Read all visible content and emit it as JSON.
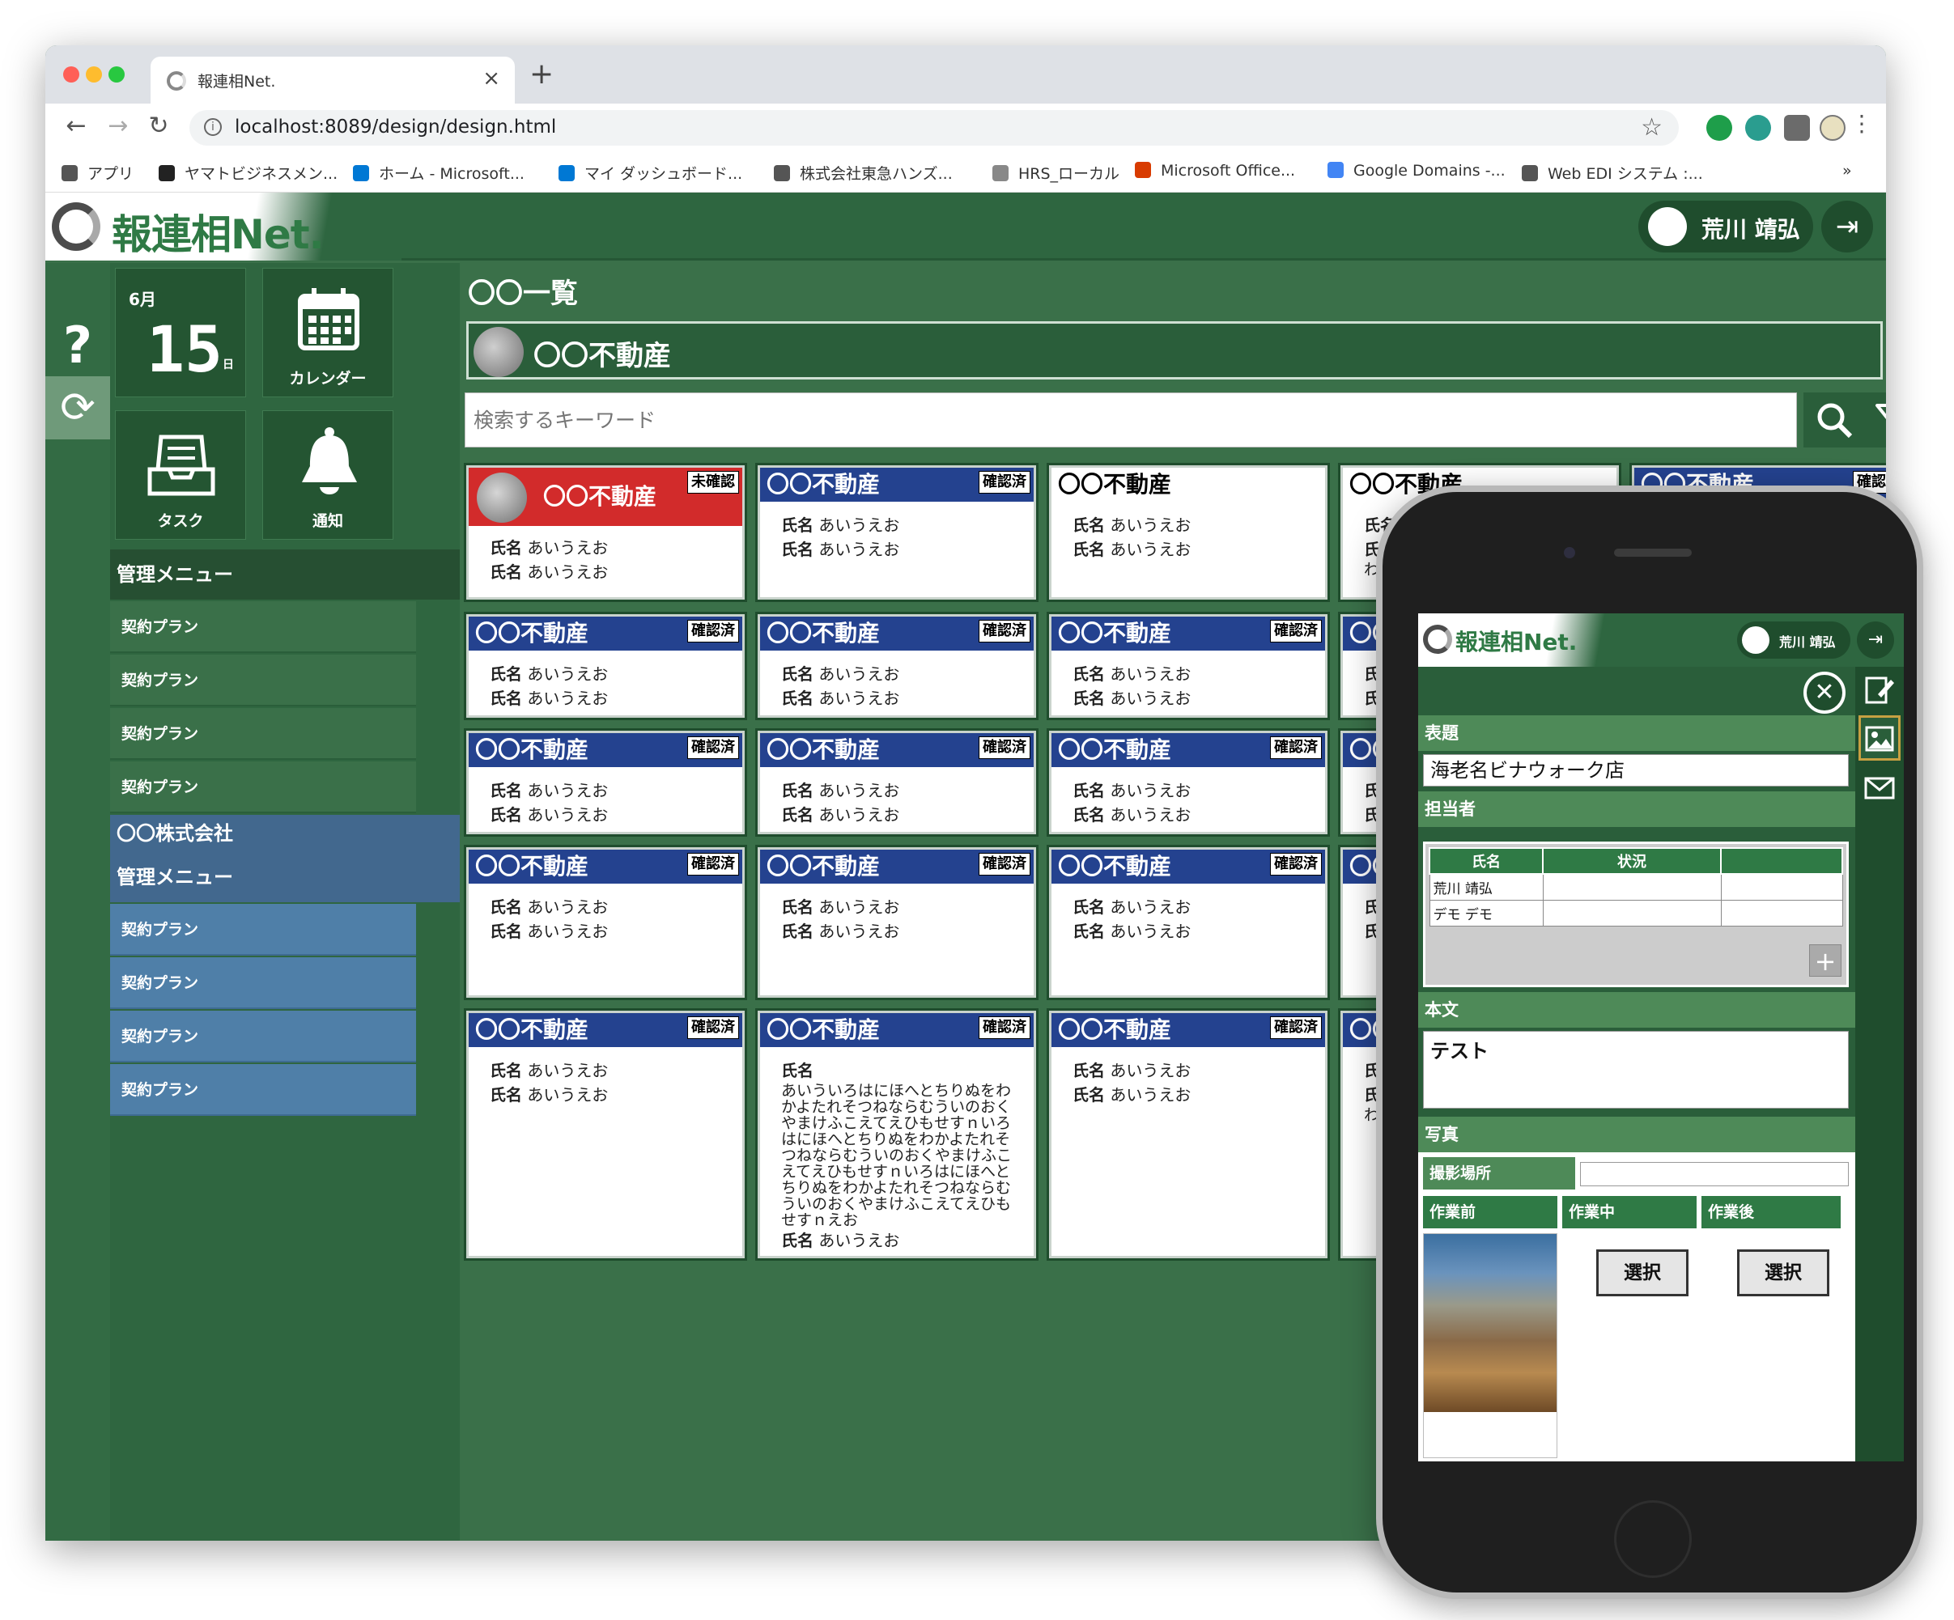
{
  "browser": {
    "tab_title": "報連相Net.",
    "tab_close": "×",
    "new_tab": "+",
    "nav": {
      "back": "←",
      "forward": "→",
      "reload": "↻"
    },
    "url_info": "i",
    "url": "localhost:8089/design/design.html",
    "star": "☆",
    "menu": "⋮",
    "bookmarks": [
      {
        "label": "アプリ",
        "icon": "apps-icon",
        "color": "#555555"
      },
      {
        "label": "ヤマトビジネスメン...",
        "icon": "yamato-icon",
        "color": "#222222"
      },
      {
        "label": "ホーム - Microsoft...",
        "icon": "azure-icon",
        "color": "#0078d4"
      },
      {
        "label": "マイ ダッシュボード...",
        "icon": "azure-icon",
        "color": "#0078d4"
      },
      {
        "label": "株式会社東急ハンズ...",
        "icon": "globe-icon",
        "color": "#555555"
      },
      {
        "label": "HRS_ローカル",
        "icon": "hrs-icon",
        "color": "#888888"
      },
      {
        "label": "Microsoft Office...",
        "icon": "office-icon",
        "color": "#d83b01"
      },
      {
        "label": "Google Domains -...",
        "icon": "google-domains-icon",
        "color": "#4285f4"
      },
      {
        "label": "Web EDI システム :...",
        "icon": "globe-icon",
        "color": "#555555"
      }
    ],
    "bookmarks_more": "»"
  },
  "app": {
    "logo": "報連相Net.",
    "user_name": "荒川 靖弘",
    "logout_icon": "⇥",
    "help": "?",
    "refresh": "⟳",
    "tiles": {
      "date_month": "6月",
      "date_day": "15",
      "date_unit": "日",
      "calendar": "カレンダー",
      "task": "タスク",
      "notice": "通知"
    },
    "menu1": {
      "title": "管理メニュー",
      "items": [
        "契約プラン",
        "契約プラン",
        "契約プラン",
        "契約プラン"
      ]
    },
    "menu2": {
      "company": "〇〇株式会社",
      "title": "管理メニュー",
      "items": [
        "契約プラン",
        "契約プラン",
        "契約プラン",
        "契約プラン"
      ]
    },
    "list_title": "〇〇一覧",
    "company_bar": "〇〇不動産",
    "search_placeholder": "検索するキーワード",
    "cards": {
      "name": "〇〇不動産",
      "status_unconfirmed": "未確認",
      "status_confirmed": "確認済",
      "field_label": "氏名",
      "field_value": "あいうえお",
      "long_text": "あいういろはにほへとちりぬをわかよたれそつねならむういのおくやまけふこえてえひもせすｎいろはにほへとちりぬをわかよたれそつねならむういのおくやまけふこえてえひもせすｎいろはにほへとちりぬをわかよたれそつねならむういのおくやまけふこえてえひもせすｎえお",
      "partial_long": "わかよいのおくｎう",
      "partial_head": "〇〇"
    }
  },
  "phone": {
    "logo": "報連相Net.",
    "user_name": "荒川 靖弘",
    "sections": {
      "title": "表題",
      "staff": "担当者",
      "body": "本文",
      "photo": "写真"
    },
    "title_value": "海老名ビナウォーク店",
    "staff_headers": [
      "氏名",
      "状況",
      ""
    ],
    "staff_rows": [
      [
        "荒川 靖弘",
        "",
        ""
      ],
      [
        "デモ デモ",
        "",
        ""
      ]
    ],
    "add_button": "+",
    "body_value": "テスト",
    "location_label": "撮影場所",
    "photo_tabs": [
      "作業前",
      "作業中",
      "作業後"
    ],
    "select_label": "選択",
    "close_icon": "✕"
  }
}
